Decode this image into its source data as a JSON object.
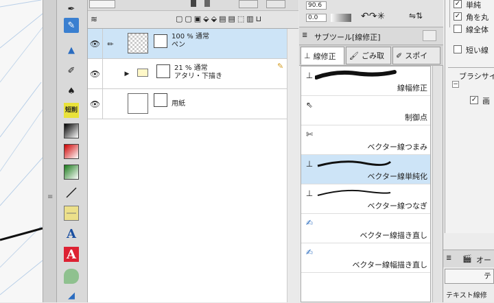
{
  "layers": [
    {
      "opacity": "100 %",
      "blend": "通常",
      "name": "ペン"
    },
    {
      "opacity": "21 %",
      "blend": "通常",
      "name": "アタリ・下描き"
    },
    {
      "name": "用紙"
    }
  ],
  "layer_top": {
    "value1": "90.6",
    "value2": "0.0"
  },
  "subtool": {
    "header": "サブツール[線修正]",
    "tabs": [
      "線修正",
      "ごみ取",
      "スポイ"
    ],
    "items": [
      {
        "label": "線幅修正",
        "icon": "line-width-icon"
      },
      {
        "label": "制御点",
        "icon": "control-point-icon"
      },
      {
        "label": "ベクター線つまみ",
        "icon": "vector-pinch-icon"
      },
      {
        "label": "ベクター線単純化",
        "icon": "vector-simplify-icon"
      },
      {
        "label": "ベクター線つなぎ",
        "icon": "vector-connect-icon"
      },
      {
        "label": "ベクター線描き直し",
        "icon": "vector-redraw-icon"
      },
      {
        "label": "ベクター線幅描き直し",
        "icon": "vector-width-redraw-icon"
      }
    ],
    "selected_index": 3
  },
  "tool_property": {
    "items": [
      "単純",
      "角を丸",
      "線全体",
      "短い線",
      "ブラシサイ",
      "画"
    ],
    "bottom_tab": "オー",
    "bottom_btn": "テ",
    "bottom_text": "テキスト線修"
  },
  "toolbar": {
    "icons": [
      "pen-icon",
      "pen-blue-icon",
      "fill-icon",
      "eyedropper-icon",
      "eraser-icon",
      "short-tool-icon",
      "gradient-dark-icon",
      "gradient-red-icon",
      "gradient-green-icon",
      "line-icon",
      "frame-icon",
      "text-a-icon",
      "text-a-red-icon",
      "balloon-icon",
      "ruler-icon"
    ],
    "short_label": "短削",
    "text_glyph": "A"
  }
}
